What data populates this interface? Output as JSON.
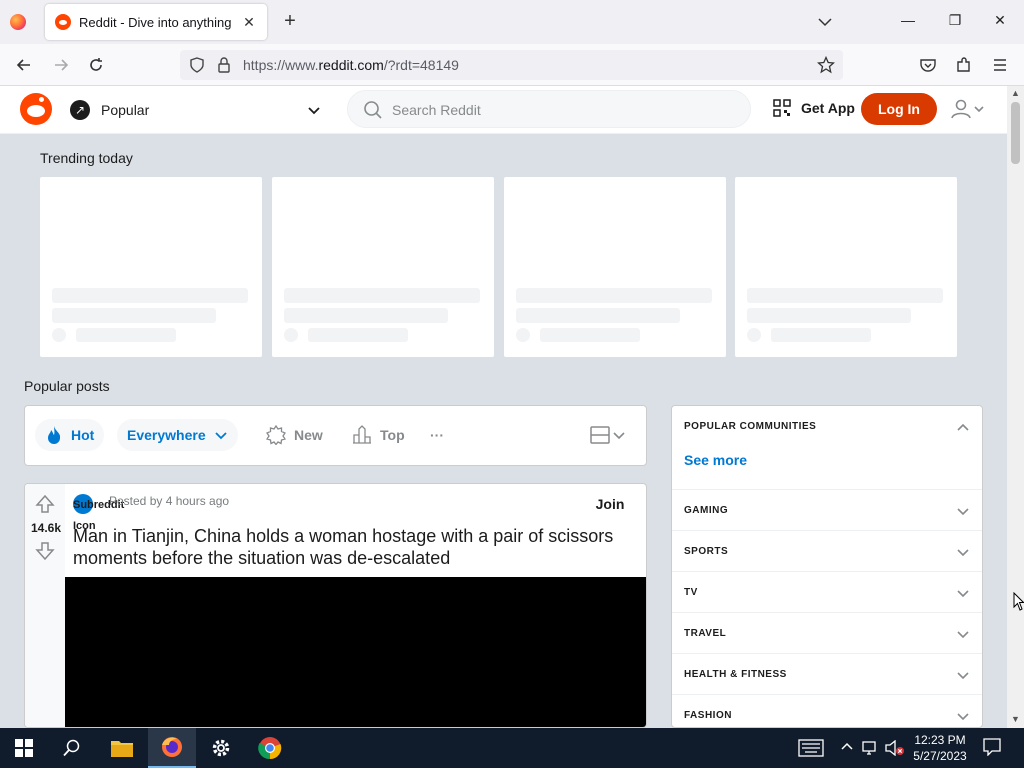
{
  "browser": {
    "tab_title": "Reddit - Dive into anything",
    "url_prefix": "https://www.",
    "url_domain": "reddit.com",
    "url_suffix": "/?rdt=48149"
  },
  "header": {
    "feed_label": "Popular",
    "search_placeholder": "Search Reddit",
    "get_app_label": "Get App",
    "login_label": "Log In"
  },
  "trending": {
    "title": "Trending today"
  },
  "popular_posts": {
    "title": "Popular posts",
    "sort": {
      "hot": "Hot",
      "location": "Everywhere",
      "new": "New",
      "top": "Top",
      "more": "···"
    }
  },
  "post": {
    "votes": "14.6k",
    "subreddit_alt": "Subreddit Icon",
    "posted_by": "Posted by 4 hours ago",
    "join_label": "Join",
    "title": "Man in Tianjin, China holds a woman hostage with a pair of scissors moments before the situation was de-escalated"
  },
  "sidebar": {
    "header": "POPULAR COMMUNITIES",
    "see_more": "See more",
    "categories": [
      "GAMING",
      "SPORTS",
      "TV",
      "TRAVEL",
      "HEALTH & FITNESS",
      "FASHION"
    ]
  },
  "taskbar": {
    "time": "12:23 PM",
    "date": "5/27/2023"
  },
  "colors": {
    "reddit_orange": "#ff4500",
    "login_bg": "#d93a00",
    "link_blue": "#0079d3",
    "page_bg": "#dae0e6",
    "taskbar_bg": "#101c2c"
  }
}
